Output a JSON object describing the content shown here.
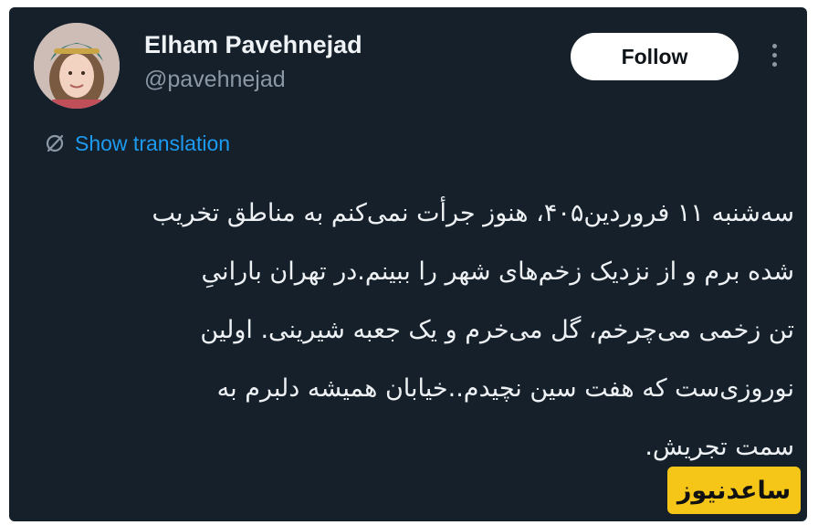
{
  "author": {
    "name": "Elham Pavehnejad",
    "handle": "@pavehnejad"
  },
  "actions": {
    "follow_label": "Follow"
  },
  "translation": {
    "label": "Show translation"
  },
  "post": {
    "lines": [
      "سه‌شنبه ۱۱ فروردین۴۰۵، هنوز جرأت نمی‌کنم به مناطق تخریب",
      "شده برم و از نزدیک زخم‌های شهر را ببینم.در تهران بارانیِ",
      "تن زخمی می‌چرخم، گل می‌خرم و یک جعبه شیرینی. اولین",
      "نوروزی‌ست که هفت سین نچیدم..خیابان همیشه دلبرم به",
      "سمت تجریش."
    ]
  },
  "watermark": {
    "text": "ساعدنیوز"
  },
  "icons": {
    "more": "more-vertical-icon",
    "translate": "translate-icon"
  },
  "colors": {
    "background": "#15202b",
    "link": "#1d9bf0",
    "secondary_text": "#8b98a5",
    "watermark_bg": "#f5c518"
  }
}
